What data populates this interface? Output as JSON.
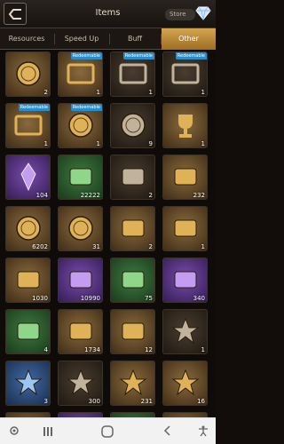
{
  "header": {
    "title": "Items",
    "store_label": "Store",
    "icons": {
      "back": "back-icon",
      "gem": "diamond-icon"
    }
  },
  "tabs": [
    {
      "label": "Resources",
      "active": false
    },
    {
      "label": "Speed Up",
      "active": false
    },
    {
      "label": "Buff",
      "active": false
    },
    {
      "label": "Other",
      "active": true
    }
  ],
  "items": [
    {
      "name": "green-coin",
      "qty": "2",
      "badge": "",
      "frame": "gold"
    },
    {
      "name": "profile-frame-purple",
      "qty": "1",
      "badge": "Redeemable",
      "frame": "gold"
    },
    {
      "name": "profile-frame-blue",
      "qty": "1",
      "badge": "Redeemable",
      "frame": "dark"
    },
    {
      "name": "profile-frame-silver",
      "qty": "1",
      "badge": "Redeemable",
      "frame": "dark"
    },
    {
      "name": "profile-frame-gold",
      "qty": "1",
      "badge": "Redeemable",
      "frame": "gold"
    },
    {
      "name": "crystal-orb",
      "qty": "1",
      "badge": "Redeemable",
      "frame": "gold"
    },
    {
      "name": "soccer-ball",
      "qty": "9",
      "badge": "",
      "frame": "dark"
    },
    {
      "name": "gold-trophy",
      "qty": "1",
      "badge": "",
      "frame": "gold"
    },
    {
      "name": "blue-crystal",
      "qty": "104",
      "badge": "",
      "frame": "purple"
    },
    {
      "name": "green-device",
      "qty": "22222",
      "badge": "",
      "frame": "green"
    },
    {
      "name": "treasure-chest",
      "qty": "2",
      "badge": "",
      "frame": "dark"
    },
    {
      "name": "blueprint-book",
      "qty": "232",
      "badge": "",
      "frame": "gold"
    },
    {
      "name": "gold-medallion",
      "qty": "6202",
      "badge": "",
      "frame": "gold"
    },
    {
      "name": "gold-coin",
      "qty": "31",
      "badge": "",
      "frame": "gold"
    },
    {
      "name": "mech-blueprint",
      "qty": "2",
      "badge": "",
      "frame": "gold"
    },
    {
      "name": "mech-blueprint-blue",
      "qty": "1",
      "badge": "",
      "frame": "gold"
    },
    {
      "name": "ammo-crate",
      "qty": "1030",
      "badge": "",
      "frame": "gold"
    },
    {
      "name": "usb-drive",
      "qty": "10990",
      "badge": "",
      "frame": "purple"
    },
    {
      "name": "data-chip",
      "qty": "75",
      "badge": "",
      "frame": "green"
    },
    {
      "name": "battery",
      "qty": "340",
      "badge": "",
      "frame": "purple"
    },
    {
      "name": "circuit-board",
      "qty": "4",
      "badge": "",
      "frame": "green"
    },
    {
      "name": "mech-eye",
      "qty": "1734",
      "badge": "",
      "frame": "gold"
    },
    {
      "name": "relocation-kit",
      "qty": "12",
      "badge": "",
      "frame": "gold"
    },
    {
      "name": "bronze-star-medal",
      "qty": "1",
      "badge": "",
      "frame": "dark"
    },
    {
      "name": "bronze-star-badge",
      "qty": "3",
      "badge": "",
      "frame": "blue"
    },
    {
      "name": "silver-star-badge",
      "qty": "300",
      "badge": "",
      "frame": "dark"
    },
    {
      "name": "gold-star-badge",
      "qty": "231",
      "badge": "",
      "frame": "gold"
    },
    {
      "name": "elite-star-badge",
      "qty": "16",
      "badge": "",
      "frame": "gold"
    },
    {
      "name": "partial-item-1",
      "qty": "",
      "badge": "",
      "frame": "gold"
    },
    {
      "name": "partial-item-2",
      "qty": "",
      "badge": "",
      "frame": "purple"
    },
    {
      "name": "partial-item-3",
      "qty": "",
      "badge": "",
      "frame": "green"
    },
    {
      "name": "partial-item-4",
      "qty": "",
      "badge": "",
      "frame": "gold"
    }
  ],
  "navbar": {
    "icons": [
      "recent-apps-icon",
      "home-icon",
      "back-nav-icon",
      "accessibility-icon"
    ]
  }
}
